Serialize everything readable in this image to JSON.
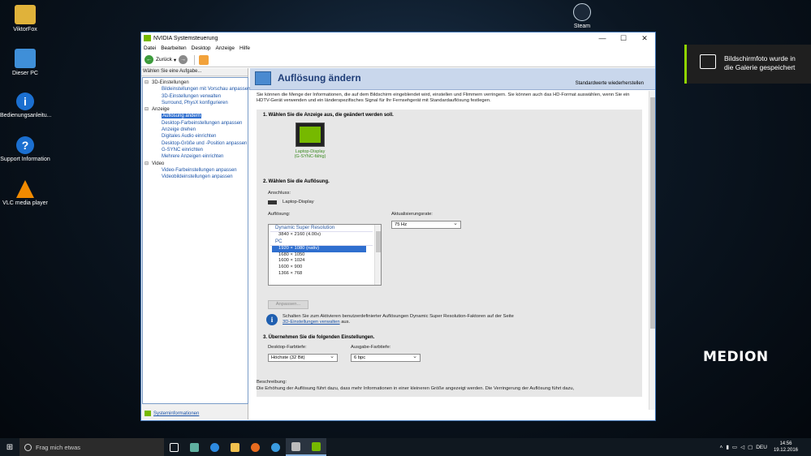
{
  "desktop": {
    "icons": [
      {
        "label": "ViktorFox",
        "color": "#e0b23a"
      },
      {
        "label": "Dieser PC",
        "color": "#3f8fd8"
      },
      {
        "label": "Bedienungsanleitu...",
        "color": "#1b6fd0"
      },
      {
        "label": "Support Information",
        "color": "#1b6fd0"
      },
      {
        "label": "VLC media player",
        "color": "#f18a00"
      },
      {
        "label": "Steam",
        "color": "#1b2838"
      }
    ],
    "brand": "MEDION"
  },
  "toast": {
    "text": "Bildschirmfoto wurde in die Galerie gespeichert"
  },
  "window": {
    "title": "NVIDIA Systemsteuerung",
    "menu": [
      "Datei",
      "Bearbeiten",
      "Desktop",
      "Anzeige",
      "Hilfe"
    ],
    "toolbar": {
      "back_label": "Zurück"
    },
    "task_header": "Wählen Sie eine Aufgabe...",
    "tree": {
      "cat_3d": "3D-Einstellungen",
      "items_3d": [
        "Bildeinstellungen mit Vorschau anpassen",
        "3D-Einstellungen verwalten",
        "Surround, PhysX konfigurieren"
      ],
      "cat_display": "Anzeige",
      "items_display": [
        "Auflösung ändern",
        "Desktop-Farbeinstellungen anpassen",
        "Anzeige drehen",
        "Digitales Audio einrichten",
        "Desktop-Größe und -Position anpassen",
        "G-SYNC einrichten",
        "Mehrere Anzeigen einrichten"
      ],
      "cat_video": "Video",
      "items_video": [
        "Video-Farbeinstellungen anpassen",
        "Videobildeinstellungen anpassen"
      ]
    },
    "sysinfo": "Systeminformationen",
    "page": {
      "title": "Auflösung ändern",
      "restore": "Standardwerte wiederherstellen",
      "intro": "Sie können die Menge der Informationen, die auf dem Bildschirm eingeblendet wird, einstellen und Flimmern verringern. Sie können auch das HD-Format auswählen, wenn Sie ein HDTV-Gerät verwenden und ein länderspezifisches Signal für Ihr Fernsehgerät mit Standardauflösung festlegen.",
      "step1": "1. Wählen Sie die Anzeige aus, die geändert werden soll.",
      "display_name": "Laptop-Display",
      "display_sub": "(G-SYNC-fähig)",
      "step2": "2. Wählen Sie die Auflösung.",
      "connection_label": "Anschluss:",
      "connection_value": "Laptop-Display",
      "resolution_label": "Auflösung:",
      "dsr_group": "Dynamic Super Resolution",
      "dsr_items": [
        "3840 × 2160 (4.00x)"
      ],
      "pc_group": "PC",
      "pc_items": [
        "1920 × 1080 (nativ)",
        "1680 × 1050",
        "1600 × 1024",
        "1600 × 900",
        "1366 × 768"
      ],
      "refresh_label": "Aktualisierungsrate:",
      "refresh_value": "75 Hz",
      "customize_button": "Anpassen...",
      "info_text_1": "Schalten Sie zum Aktivieren benutzerdefinierter Auflösungen Dynamic Super Resolution-Faktoren auf der Seite",
      "info_link": "3D-Einstellungen verwalten",
      "info_text_2": "aus.",
      "step3": "3. Übernehmen Sie die folgenden Einstellungen.",
      "desktop_depth_label": "Desktop-Farbtiefe:",
      "desktop_depth_value": "Höchste (32 Bit)",
      "output_depth_label": "Ausgabe-Farbtiefe:",
      "output_depth_value": "6 bpc",
      "description_label": "Beschreibung:",
      "description_text": "Die Erhöhung der Auflösung führt dazu, dass mehr Informationen in einer kleineren Größe angezeigt werden. Die Verringerung der Auflösung führt dazu,"
    }
  },
  "taskbar": {
    "search_placeholder": "Frag mich etwas",
    "apps": [
      {
        "name": "task-view",
        "color": "#ffffff"
      },
      {
        "name": "edge-alt",
        "color": "#5fb0a0"
      },
      {
        "name": "edge",
        "color": "#2d8ae0"
      },
      {
        "name": "explorer",
        "color": "#f2c14e"
      },
      {
        "name": "firefox",
        "color": "#e76b1f"
      },
      {
        "name": "ie",
        "color": "#3a9be0"
      },
      {
        "name": "snipping",
        "color": "#bcbcbc"
      },
      {
        "name": "nvidia",
        "color": "#76b900"
      }
    ],
    "lang": "DEU",
    "time": "14:56",
    "date": "19.12.2016"
  }
}
